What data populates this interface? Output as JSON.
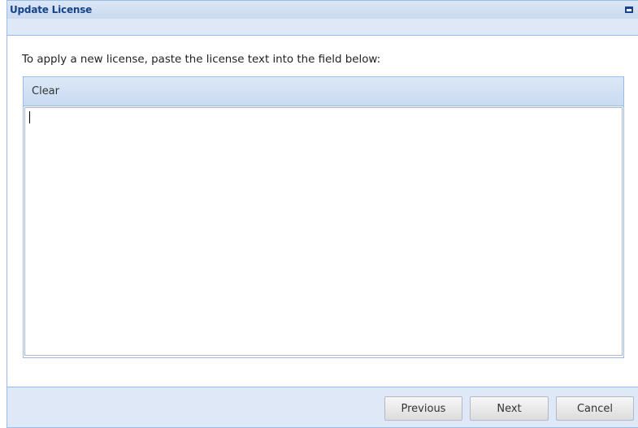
{
  "window": {
    "title": "Update License"
  },
  "instructions": "To apply a new license, paste the license text into the field below:",
  "panel": {
    "clear_label": "Clear",
    "license_text": ""
  },
  "footer": {
    "previous_label": "Previous",
    "next_label": "Next",
    "cancel_label": "Cancel"
  },
  "icons": {
    "maximize": "maximize-icon",
    "close": "close-icon"
  },
  "colors": {
    "title_text": "#15428b",
    "border": "#99bbe8",
    "frame_background": "#dfe8f6"
  }
}
